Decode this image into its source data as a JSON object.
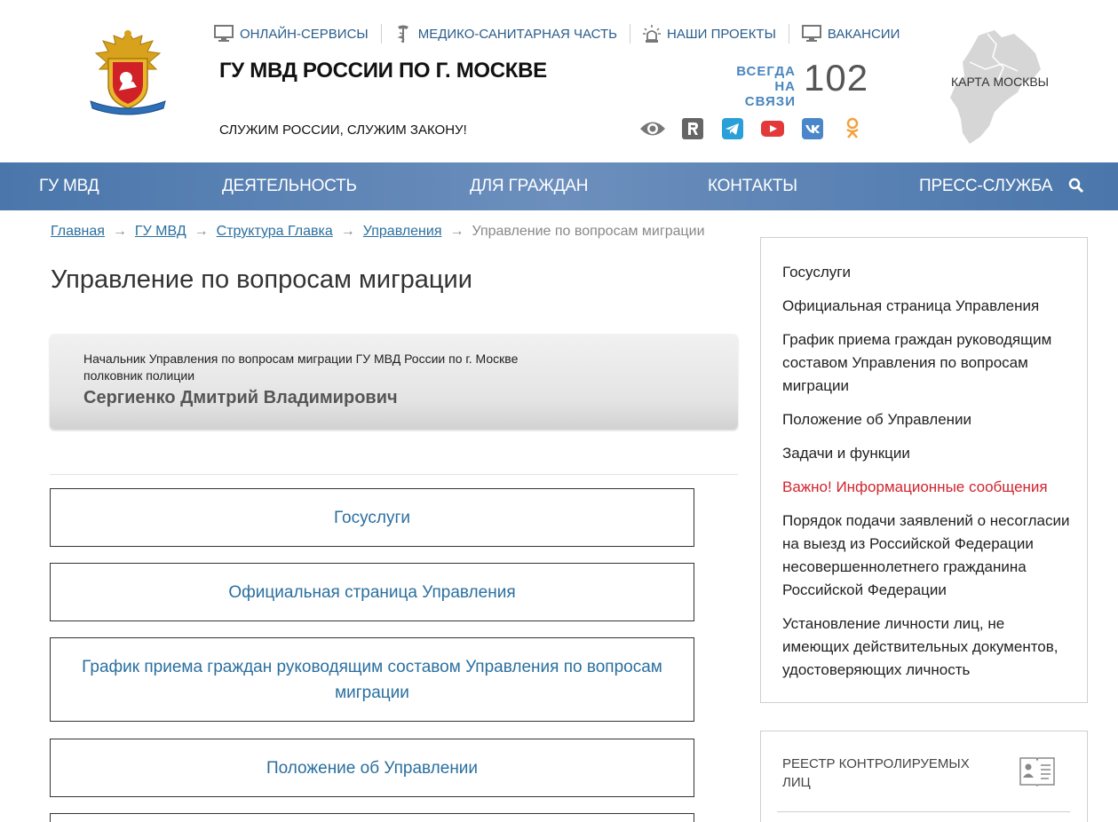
{
  "header": {
    "top_links": [
      {
        "label": "ОНЛАЙН-СЕРВИСЫ",
        "icon": "monitor-icon"
      },
      {
        "label": "МЕДИКО-САНИТАРНАЯ ЧАСТЬ",
        "icon": "caduceus-icon"
      },
      {
        "label": "НАШИ ПРОЕКТЫ",
        "icon": "siren-icon"
      },
      {
        "label": "ВАКАНСИИ",
        "icon": "monitor-icon"
      }
    ],
    "title": "ГУ МВД РОССИИ ПО Г. МОСКВЕ",
    "motto": "СЛУЖИМ РОССИИ, СЛУЖИМ ЗАКОНУ!",
    "hotline_line1": "ВСЕГДА",
    "hotline_line2": "НА СВЯЗИ",
    "hotline_number": "102",
    "map_label": "КАРТА МОСКВЫ",
    "social": [
      "eye-icon",
      "rutube-icon",
      "telegram-icon",
      "youtube-icon",
      "vk-icon",
      "odnoklassniki-icon"
    ]
  },
  "nav": {
    "items": [
      "ГУ МВД",
      "ДЕЯТЕЛЬНОСТЬ",
      "ДЛЯ ГРАЖДАН",
      "КОНТАКТЫ",
      "ПРЕСС-СЛУЖБА"
    ],
    "search_icon": "search-icon"
  },
  "breadcrumbs": {
    "links": [
      "Главная",
      "ГУ МВД",
      "Структура Главка",
      "Управления"
    ],
    "current": "Управление по вопросам миграции",
    "separator": "→"
  },
  "page": {
    "title": "Управление по вопросам миграции",
    "chief": {
      "position_line1": "Начальник Управления по вопросам миграции ГУ МВД России по г. Москве",
      "position_line2": "полковник полиции",
      "name": "Сергиенко Дмитрий Владимирович"
    },
    "cards": [
      "Госуслуги",
      "Официальная страница Управления",
      "График приема граждан руководящим составом Управления по вопросам миграции",
      "Положение об Управлении"
    ]
  },
  "sidebar": {
    "items": [
      {
        "label": "Госуслуги",
        "important": false
      },
      {
        "label": "Официальная страница Управления",
        "important": false
      },
      {
        "label": "График приема граждан руководящим составом Управления по вопросам миграции",
        "important": false
      },
      {
        "label": "Положение об Управлении",
        "important": false
      },
      {
        "label": "Задачи и функции",
        "important": false
      },
      {
        "label": "Важно! Информационные сообщения",
        "important": true
      },
      {
        "label": "Порядок подачи заявлений о несогласии на выезд из Российской Федерации несовершеннолетнего гражданина Российской Федерации",
        "important": false
      },
      {
        "label": "Установление личности лиц, не имеющих действительных документов, удостоверяющих личность",
        "important": false
      }
    ],
    "registry_label": "РЕЕСТР КОНТРОЛИРУЕМЫХ ЛИЦ"
  },
  "colors": {
    "nav_bg": "#5a80b3",
    "link": "#2a6f9f",
    "important": "#d0252e",
    "hotline": "#4a86bd"
  }
}
